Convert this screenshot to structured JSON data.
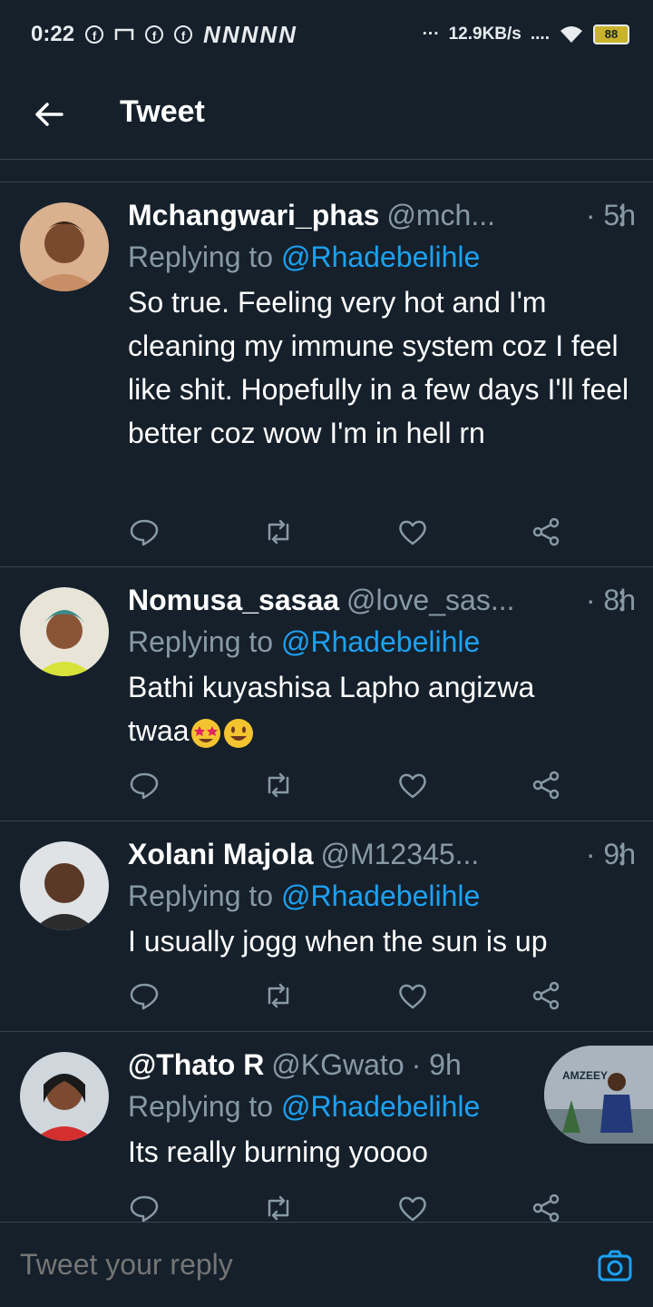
{
  "status_bar": {
    "time": "0:22",
    "network": "NNNNN",
    "dots": "···",
    "speed": "12.9KB/s",
    "signal_dots": "....",
    "battery": "88"
  },
  "header": {
    "title": "Tweet"
  },
  "tweets": [
    {
      "display_name": "Mchangwari_phas",
      "handle": "@mch...",
      "time": "· 5h",
      "replying_label": "Replying to",
      "replying_to": "@Rhadebelihle",
      "text": "So true. Feeling very hot and I'm cleaning my immune system coz I feel like shit. Hopefully in a few days I'll feel better coz wow I'm in hell rn"
    },
    {
      "display_name": "Nomusa_sasaa",
      "handle": "@love_sas...",
      "time": "· 8h",
      "replying_label": "Replying to",
      "replying_to": "@Rhadebelihle",
      "text": "Bathi kuyashisa Lapho angizwa twaa"
    },
    {
      "display_name": "Xolani Majola",
      "handle": "@M12345...",
      "time": "· 9h",
      "replying_label": "Replying to",
      "replying_to": "@Rhadebelihle",
      "text": "I usually jogg when the sun is up"
    },
    {
      "display_name": "@Thato R",
      "handle": "@KGwato",
      "time": "· 9h",
      "replying_label": "Replying to",
      "replying_to": "@Rhadebelihle",
      "text": "Its really burning yoooo"
    }
  ],
  "floating_thumb": {
    "label": "AMZEEY"
  },
  "reply_bar": {
    "placeholder": "Tweet your reply"
  },
  "colors": {
    "background": "#15202b",
    "accent": "#1da1f2",
    "muted": "#8899a6",
    "divider": "#38444d"
  }
}
